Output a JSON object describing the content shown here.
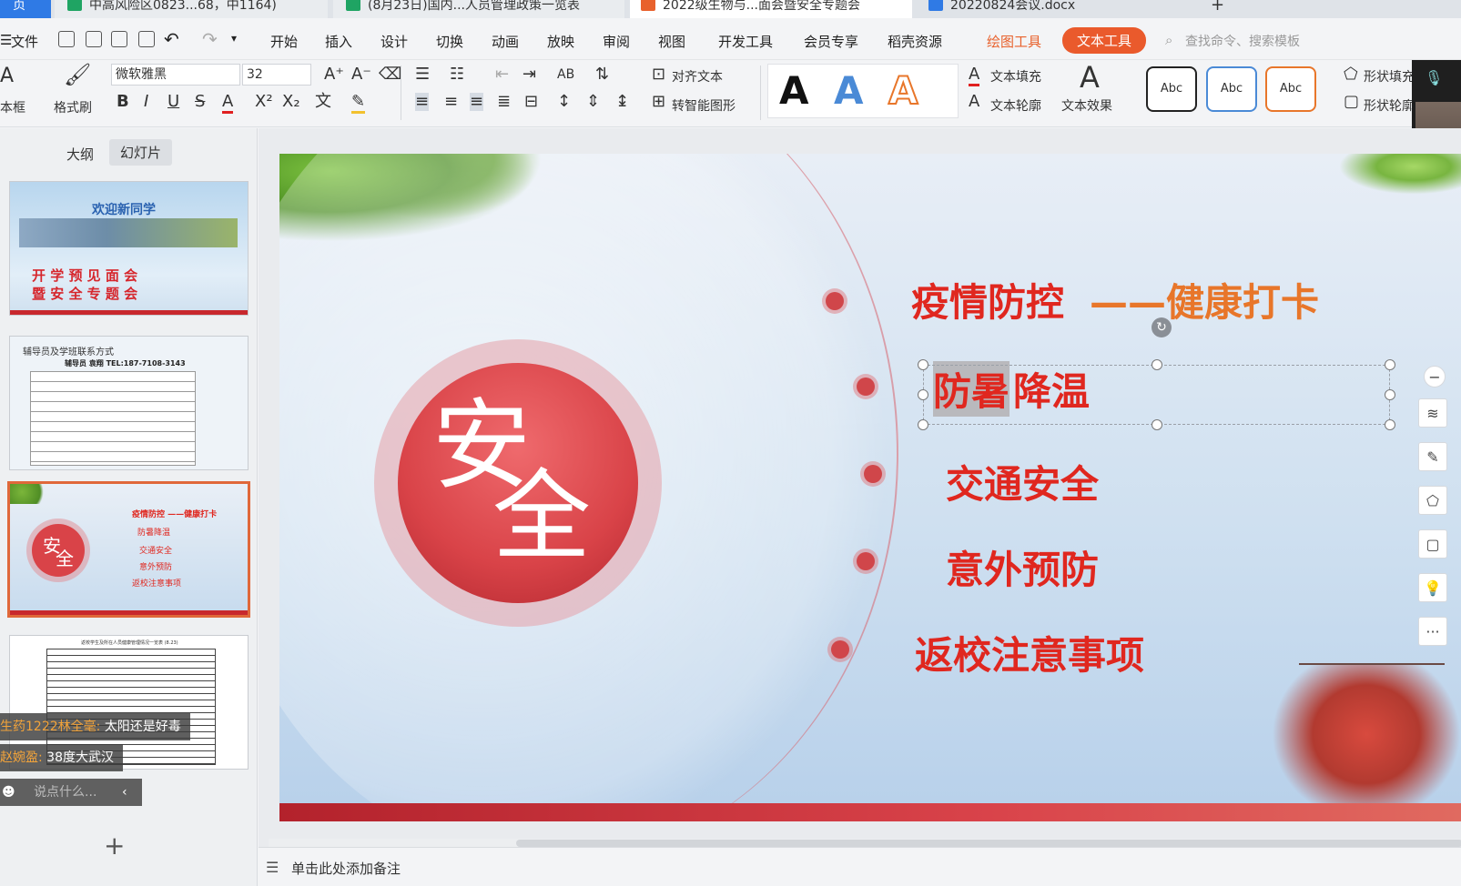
{
  "tabs": [
    {
      "label": "页",
      "color": "#2f7ae5"
    },
    {
      "label": "中高风险区0823...68，中1164)",
      "color": "#1fa463"
    },
    {
      "label": "(8月23日)国内...人员管理政策一览表",
      "color": "#1fa463"
    },
    {
      "label": "2022级生物与...面会暨安全专题会",
      "color": "#e8612c"
    },
    {
      "label": "20220824会议.docx",
      "color": "#2f7ae5"
    },
    {
      "label": "+"
    }
  ],
  "menu": {
    "file": "文件",
    "items": [
      "开始",
      "插入",
      "设计",
      "切换",
      "动画",
      "放映",
      "审阅",
      "视图",
      "开发工具",
      "会员专享",
      "稻壳资源"
    ],
    "drawing_tools": "绘图工具",
    "text_tools": "文本工具",
    "search_placeholder": "查找命令、搜索模板"
  },
  "ribbon": {
    "textbox": "本框",
    "format_painter": "格式刷",
    "font_name": "微软雅黑",
    "font_size": "32",
    "align_text": "对齐文本",
    "smart_shape": "转智能图形",
    "text_fill": "文本填充",
    "text_outline": "文本轮廓",
    "text_effect": "文本效果",
    "shape_fill": "形状填充",
    "shape_outline": "形状轮廓",
    "style_sample": "Abc",
    "art_letter": "A"
  },
  "left_pane": {
    "tab_outline": "大纲",
    "tab_slides": "幻灯片",
    "thumb1": {
      "title": "欢迎新同学",
      "line1": "开 学 预 见 面 会",
      "line2": "暨 安 全 专 题 会"
    },
    "thumb2": {
      "title": "辅导员及学班联系方式",
      "sub": "辅导员        袁翔    TEL:187-7108-3143"
    },
    "thumb3_items": [
      "疫情防控 ——健康打卡",
      "防暑降温",
      "交通安全",
      "意外预防",
      "返校注意事项"
    ],
    "thumb4": {
      "title": "返校学生及所在人员健康管理情况一览表 (8.23)"
    },
    "add": "+"
  },
  "chat": [
    {
      "name": "生药1222林全毫:",
      "msg": "太阳还是好毒"
    },
    {
      "name": "赵婉盈:",
      "msg": "38度大武汉"
    }
  ],
  "chat_input": "说点什么...",
  "slide": {
    "big1": "安",
    "big2": "全",
    "items": [
      "疫情防控",
      "——健康打卡",
      "防暑",
      "降温",
      "交通安全",
      "意外预防",
      "返校注意事项"
    ],
    "title_color": "#e0271f",
    "accent": "#e8762a"
  },
  "notes": "单击此处添加备注",
  "right_tools": [
    "minus-icon",
    "layers-icon",
    "pen-icon",
    "shape-fill-icon",
    "frame-icon",
    "bulb-icon",
    "more-icon"
  ],
  "right_tools_more": "···"
}
